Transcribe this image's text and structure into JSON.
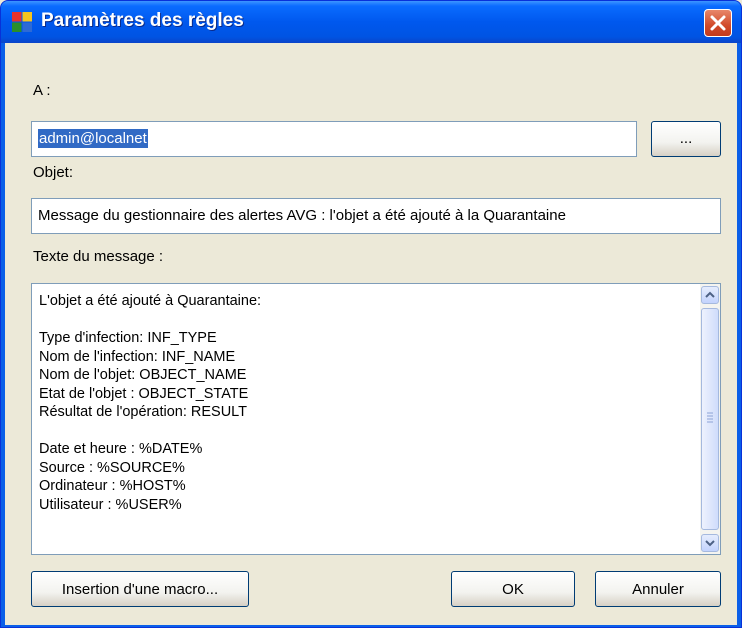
{
  "window": {
    "title": "Paramètres des règles"
  },
  "form": {
    "to_label": "A :",
    "to_value": "admin@localnet",
    "browse_label": "...",
    "subject_label": "Objet:",
    "subject_value": "Message du gestionnaire des alertes AVG : l'objet a été ajouté à la Quarantaine",
    "body_label": "Texte du message :",
    "body_lines": [
      "L'objet a été ajouté à Quarantaine:",
      "",
      "Type d'infection: INF_TYPE",
      "Nom de l'infection: INF_NAME",
      "Nom de l'objet: OBJECT_NAME",
      "Etat de l'objet : OBJECT_STATE",
      "Résultat de l'opération: RESULT",
      "",
      "Date et heure : %DATE%",
      "Source : %SOURCE%",
      "Ordinateur : %HOST%",
      "Utilisateur : %USER%"
    ]
  },
  "buttons": {
    "insert_macro": "Insertion d'une macro...",
    "ok": "OK",
    "cancel": "Annuler"
  },
  "icons": {
    "app": "avg-app-icon",
    "close": "close-icon",
    "scroll_up": "arrow-up-icon",
    "scroll_down": "arrow-down-icon"
  },
  "colors": {
    "titlebar": "#0054e3",
    "close_button": "#d14a2a",
    "selection": "#316ac5",
    "dialog_bg": "#ece9d8"
  }
}
